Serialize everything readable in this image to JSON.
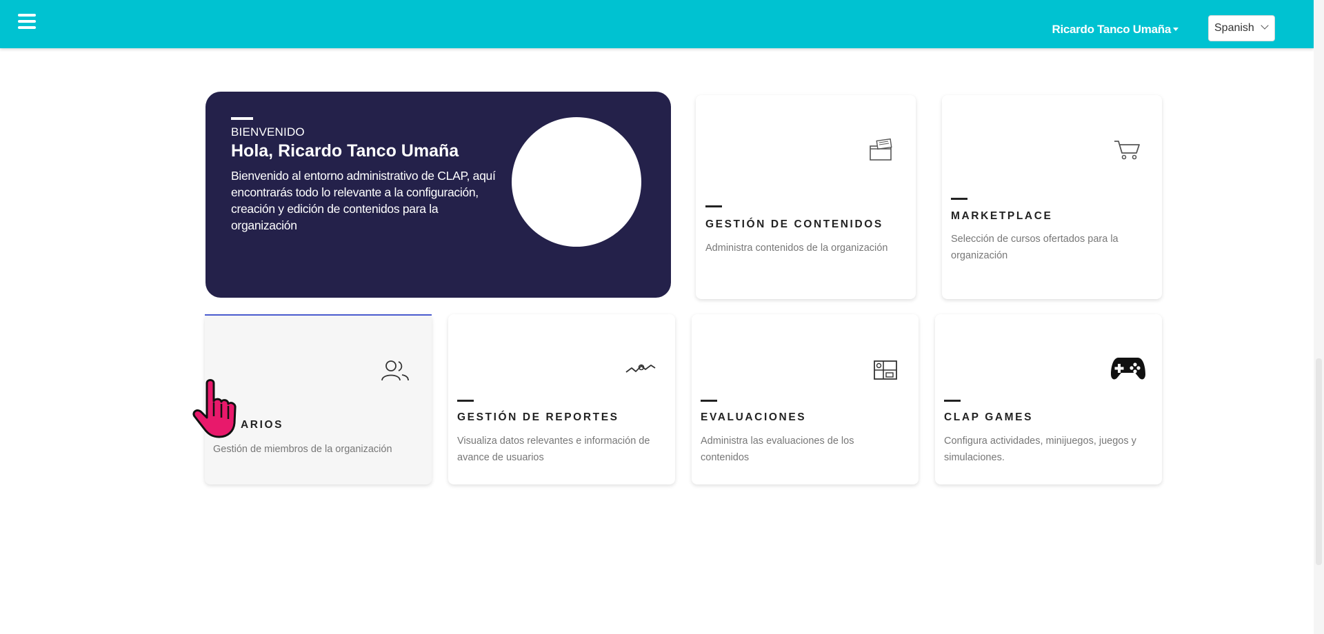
{
  "header": {
    "user_name": "Ricardo Tanco Umaña",
    "language": "Spanish"
  },
  "welcome": {
    "eyebrow": "BIENVENIDO",
    "greeting": "Hola, Ricardo Tanco Umaña",
    "description": "Bienvenido al entorno administrativo de CLAP, aquí encontrarás todo lo relevante a la configuración, creación y edición de contenidos para la organización"
  },
  "cards": {
    "contenidos": {
      "title": "GESTIÓN DE CONTENIDOS",
      "desc": "Administra contenidos de la organización",
      "icon": "folder-icon"
    },
    "marketplace": {
      "title": "MARKETPLACE",
      "desc": "Selección de cursos ofertados para la organización",
      "icon": "cart-icon"
    },
    "usuarios": {
      "title": "ARIOS",
      "desc": "Gestión de miembros de la organización",
      "icon": "users-icon"
    },
    "reportes": {
      "title": "GESTIÓN DE REPORTES",
      "desc": "Visualiza datos relevantes e información de avance de usuarios",
      "icon": "chart-icon"
    },
    "evaluaciones": {
      "title": "EVALUACIONES",
      "desc": "Administra las evaluaciones de los contenidos",
      "icon": "grid-icon"
    },
    "games": {
      "title": "CLAP GAMES",
      "desc": "Configura actividades, minijuegos, juegos y simulaciones.",
      "icon": "gamepad-icon"
    }
  },
  "colors": {
    "topbar": "#00c2d1",
    "welcome_bg": "#24214a",
    "cursor": "#e8196b"
  }
}
